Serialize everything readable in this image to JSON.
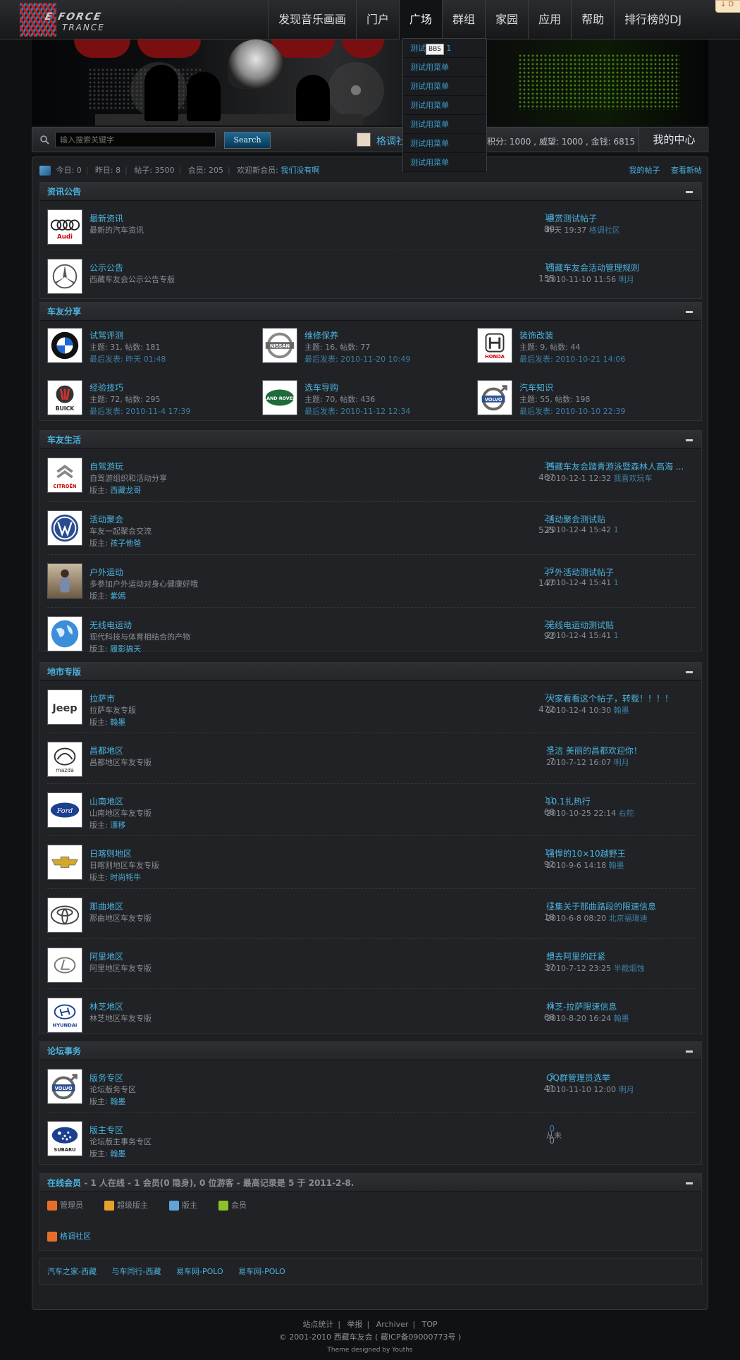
{
  "nav": {
    "items": [
      "发现音乐画画",
      "门户",
      "广场",
      "群组",
      "家园",
      "应用",
      "帮助",
      "排行榜的DJ"
    ],
    "active_index": 2,
    "corner_badge": "↓ D"
  },
  "logo": {
    "line1": "E FORCE",
    "line2": "TRANCE"
  },
  "dropdown": {
    "items": [
      "测试",
      "测试用菜单",
      "测试用菜单",
      "测试用菜单",
      "测试用菜单",
      "测试用菜单",
      "测试用菜单"
    ],
    "tooltip": "BBS",
    "tooltip_suffix": "1"
  },
  "search": {
    "placeholder": "输入搜索关键字",
    "button": "Search"
  },
  "user": {
    "name": "格调社",
    "stats": "积分: 1000 , 威望: 1000 , 金钱: 6815",
    "center": "我的中心"
  },
  "statbar": {
    "today": "今日: 0",
    "yesterday": "昨日: 8",
    "posts": "帖子: 3500",
    "members": "会员: 205",
    "welcome": "欢迎新会员:",
    "newest": "我们没有啊",
    "my_posts": "我的帖子",
    "view_new": "查看新帖"
  },
  "sections": {
    "news": {
      "title": "资讯公告",
      "forums": [
        {
          "name": "最新资讯",
          "desc": "最新的汽车资讯",
          "threads": "18",
          "posts": "80",
          "last_title": "悬赏测试帖子",
          "last_time": "昨天 19:37",
          "last_user": "格调社区",
          "logo": "audi-logo"
        },
        {
          "name": "公示公告",
          "desc": "西藏车友会公示公告专版",
          "threads": "13",
          "posts": "155",
          "last_title": "西藏车友会活动管理规则",
          "last_time": "2010-11-10 11:56",
          "last_user": "明月",
          "logo": "mercedes-logo"
        }
      ]
    },
    "share": {
      "title": "车友分享",
      "forums": [
        {
          "name": "试驾评测",
          "stats": "主题: 31, 帖数: 181",
          "last": "最后发表: 昨天 01:48",
          "logo": "bmw-logo"
        },
        {
          "name": "维修保养",
          "stats": "主题: 16, 帖数: 77",
          "last": "最后发表: 2010-11-20 10:49",
          "logo": "nissan-logo"
        },
        {
          "name": "装饰改装",
          "stats": "主题: 9, 帖数: 44",
          "last": "最后发表: 2010-10-21 14:06",
          "logo": "honda-logo"
        },
        {
          "name": "经验技巧",
          "stats": "主题: 72, 帖数: 295",
          "last": "最后发表: 2010-11-4 17:39",
          "logo": "buick-logo"
        },
        {
          "name": "选车导购",
          "stats": "主题: 70, 帖数: 436",
          "last": "最后发表: 2010-11-12 12:34",
          "logo": "landrover-logo"
        },
        {
          "name": "汽车知识",
          "stats": "主题: 55, 帖数: 198",
          "last": "最后发表: 2010-10-10 22:39",
          "logo": "volvo-logo"
        }
      ]
    },
    "life": {
      "title": "车友生活",
      "forums": [
        {
          "name": "自驾游玩",
          "desc": "自驾游组织和活动分享",
          "mod_label": "版主:",
          "mod": "西藏龙哥",
          "threads": "34",
          "posts": "467",
          "last_title": "西藏车友会踏青游泳暨森林人高海 ...",
          "last_time": "2010-12-1 12:32",
          "last_user": "我喜欢玩车",
          "logo": "citroen-logo"
        },
        {
          "name": "活动聚会",
          "desc": "车友一起聚会交流",
          "mod_label": "版主:",
          "mod": "孩子他爸",
          "threads": "24",
          "posts": "525",
          "last_title": "活动聚会测试贴",
          "last_time": "2010-12-4 15:42",
          "last_user": "1",
          "logo": "vw-logo"
        },
        {
          "name": "户外运动",
          "desc": "多参加户外运动对身心健康好哦",
          "mod_label": "版主:",
          "mod": "紫嫣",
          "threads": "27",
          "posts": "147",
          "last_title": "户外活动测试帖子",
          "last_time": "2010-12-4 15:41",
          "last_user": "1",
          "logo": "outdoor-photo"
        },
        {
          "name": "无线电运动",
          "desc": "现代科技与体育相结合的产物",
          "mod_label": "版主:",
          "mod": "履影搞天",
          "threads": "22",
          "posts": "92",
          "last_title": "无线电运动测试贴",
          "last_time": "2010-12-4 15:41",
          "last_user": "1",
          "logo": "globe-image"
        }
      ]
    },
    "region": {
      "title": "地市专版",
      "forums": [
        {
          "name": "拉萨市",
          "desc": "拉萨车友专版",
          "mod_label": "版主:",
          "mod": "翰墨",
          "threads": "70",
          "posts": "472",
          "last_title": "大家看看这个帖子，转载！！！！",
          "last_time": "2010-12-4 10:30",
          "last_user": "翰墨",
          "logo": "jeep-logo"
        },
        {
          "name": "昌都地区",
          "desc": "昌都地区车友专版",
          "threads": "1",
          "posts": "7",
          "last_title": "圣洁 美丽的昌都欢迎你！",
          "last_time": "2010-7-12 16:07",
          "last_user": "明月",
          "logo": "mazda-logo"
        },
        {
          "name": "山南地区",
          "desc": "山南地区车友专版",
          "mod_label": "版主:",
          "mod": "漂移",
          "threads": "11",
          "posts": "68",
          "last_title": "10.1扎热行",
          "last_time": "2010-10-25 22:14",
          "last_user": "右舵",
          "logo": "ford-logo"
        },
        {
          "name": "日喀则地区",
          "desc": "日喀则地区车友专版",
          "mod_label": "版主:",
          "mod": "时尚牦牛",
          "threads": "12",
          "posts": "92",
          "last_title": "强悍的10×10越野王",
          "last_time": "2010-9-6 14:18",
          "last_user": "翰墨",
          "logo": "chevrolet-logo"
        },
        {
          "name": "那曲地区",
          "desc": "那曲地区车友专版",
          "threads": "1",
          "posts": "18",
          "last_title": "征集关于那曲路段的限速信息",
          "last_time": "2010-6-8 08:20",
          "last_user": "北京福瑞迪",
          "logo": "toyota-logo"
        },
        {
          "name": "阿里地区",
          "desc": "阿里地区车友专版",
          "threads": "3",
          "posts": "37",
          "last_title": "想去阿里的赶紧",
          "last_time": "2010-7-12 23:25",
          "last_user": "半截烟蚀",
          "logo": "lexus-logo"
        },
        {
          "name": "林芝地区",
          "desc": "林芝地区车友专版",
          "threads": "5",
          "posts": "68",
          "last_title": "林芝-拉萨限速信息",
          "last_time": "2010-8-20 16:24",
          "last_user": "翰墨",
          "logo": "hyundai-logo"
        }
      ]
    },
    "affairs": {
      "title": "论坛事务",
      "forums": [
        {
          "name": "版务专区",
          "desc": "论坛版务专区",
          "mod_label": "版主:",
          "mod": "翰墨",
          "threads": "3",
          "posts": "41",
          "last_title": "QQ群管理员选举",
          "last_time": "2010-11-10 12:00",
          "last_user": "明月",
          "logo": "volvo-logo"
        },
        {
          "name": "版主专区",
          "desc": "论坛版主事务专区",
          "mod_label": "版主:",
          "mod": "翰墨",
          "threads": "0",
          "posts": "0",
          "last_title": "",
          "last_time": "从未",
          "last_user": "",
          "logo": "subaru-logo"
        }
      ]
    },
    "online": {
      "title": "在线会员",
      "summary": " - 1 人在线 - 1 会员(0 隐身), 0 位游客 - 最高记录是 5 于 2011-2-8.",
      "legend": [
        "管理员",
        "超级版主",
        "版主",
        "会员"
      ],
      "legend_colors": [
        "#e86d2a",
        "#e8a12a",
        "#5fa5d8",
        "#8cc12a"
      ],
      "user": "格调社区"
    }
  },
  "friend_links": [
    "汽车之家-西藏",
    "与车同行-西藏",
    "易车网-POLO",
    "易车网-POLO"
  ],
  "footer": {
    "links": [
      "站点统计",
      "举报",
      "Archiver",
      "TOP"
    ],
    "copyright": "© 2001-2010 西藏车友会 ( 藏ICP备09000773号 )",
    "designer": "Theme designed by Youths"
  }
}
